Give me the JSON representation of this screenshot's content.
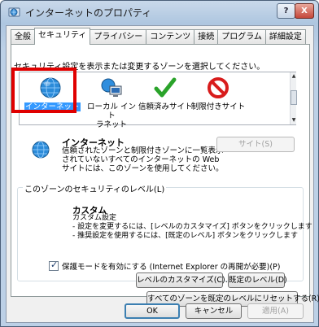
{
  "window": {
    "title": "インターネットのプロパティ",
    "help_label": "?",
    "close_label": "X"
  },
  "tabs": [
    {
      "label": "全般",
      "active": false
    },
    {
      "label": "セキュリティ",
      "active": true
    },
    {
      "label": "プライバシー",
      "active": false
    },
    {
      "label": "コンテンツ",
      "active": false
    },
    {
      "label": "接続",
      "active": false
    },
    {
      "label": "プログラム",
      "active": false
    },
    {
      "label": "詳細設定",
      "active": false
    }
  ],
  "security": {
    "instruction": "セキュリティ設定を表示または変更するゾーンを選択してください。",
    "zones": [
      {
        "label": "インターネット",
        "icon": "globe-icon",
        "selected": true
      },
      {
        "label": "ローカル イント\nラネット",
        "icon": "network-computer-icon",
        "selected": false
      },
      {
        "label": "信頼済みサイト",
        "icon": "green-check-icon",
        "selected": false
      },
      {
        "label": "制限付きサイト",
        "icon": "red-prohibited-icon",
        "selected": false
      }
    ],
    "zone_info": {
      "name": "インターネット",
      "description": "信頼されたゾーンと制限付きゾーンに一覧表示されていないすべてのインターネットの Web サイトには、このゾーンを使用してください。",
      "sites_button": "サイト(S)"
    },
    "level_group": {
      "title": "このゾーンのセキュリティのレベル(L)",
      "level_name": "カスタム",
      "level_desc_1": "カスタム設定",
      "level_desc_2": " - 設定を変更するには、[レベルのカスタマイズ] ボタンをクリックします",
      "level_desc_3": " - 推奨設定を使用するには、[既定のレベル] ボタンをクリックします",
      "protected_mode_label": "保護モードを有効にする (Internet Explorer の再開が必要)(P)",
      "protected_mode_checked": true,
      "custom_level_button": "レベルのカスタマイズ(C)...",
      "default_level_button": "既定のレベル(D)"
    },
    "reset_all_button": "すべてのゾーンを既定のレベルにリセットする(R)"
  },
  "footer": {
    "ok": "OK",
    "cancel": "キャンセル",
    "apply": "適用(A)"
  },
  "colors": {
    "selection": "#3399ff",
    "highlight_frame": "#e00000"
  }
}
